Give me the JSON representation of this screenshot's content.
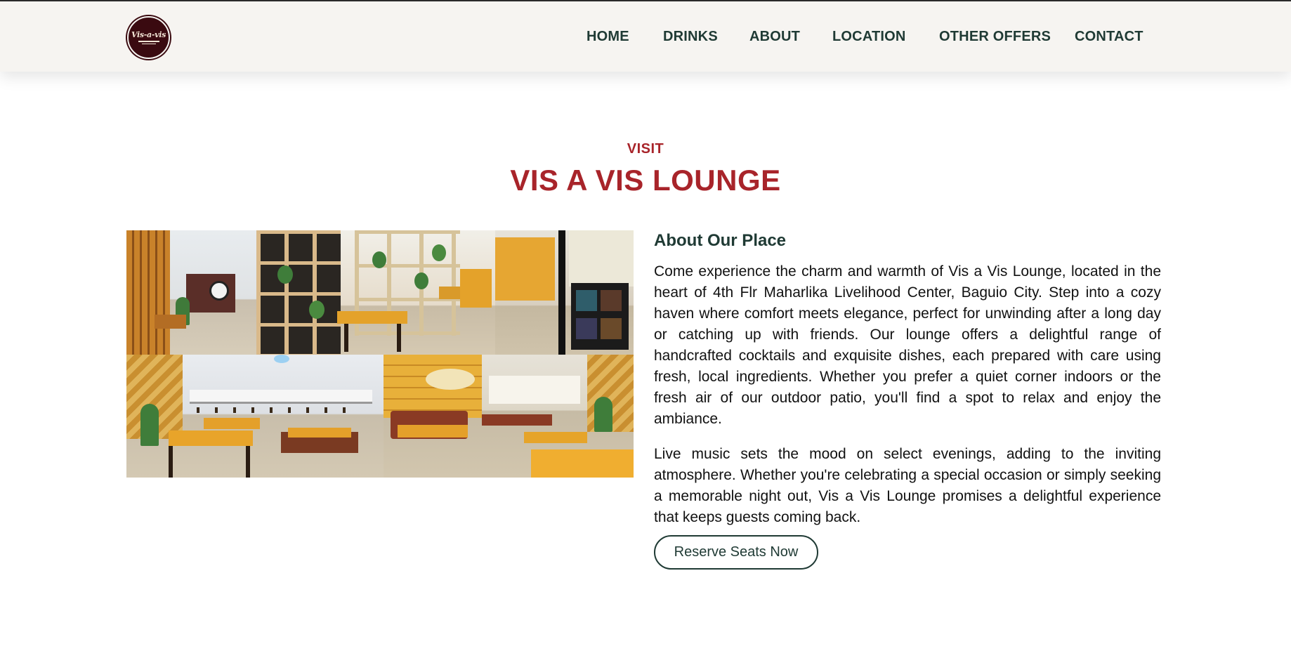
{
  "brand": {
    "logo_text": "Vis-a-vis",
    "logo_sub": "LOUNGE",
    "logo_city": "BAGUIO CITY",
    "logo_bg": "#3a0a10"
  },
  "nav": {
    "items": [
      "HOME",
      "DRINKS",
      "ABOUT",
      "LOCATION",
      "OTHER OFFERS",
      "CONTACT"
    ],
    "color": "#1f3a34"
  },
  "section": {
    "kicker": "VISIT",
    "title": "VIS A VIS LOUNGE",
    "accent": "#a8242a"
  },
  "about": {
    "heading": "About Our Place",
    "paragraph1": "Come experience the charm and warmth of Vis a Vis Lounge, located in the heart of 4th Flr Maharlika Livelihood Center, Baguio City. Step into a cozy haven where comfort meets elegance, perfect for unwinding after a long day or catching up with friends. Our lounge offers a delightful range of handcrafted cocktails and exquisite dishes, each prepared with care using fresh, local ingredients. Whether you prefer a quiet corner indoors or the fresh air of our outdoor patio, you'll find a spot to relax and enjoy the ambiance.",
    "paragraph2": "Live music sets the mood on select evenings, adding to the inviting atmosphere. Whether you're celebrating a special occasion or simply seeking a memorable night out, Vis a Vis Lounge promises a delightful experience that keeps guests coming back.",
    "button_label": "Reserve Seats Now"
  }
}
